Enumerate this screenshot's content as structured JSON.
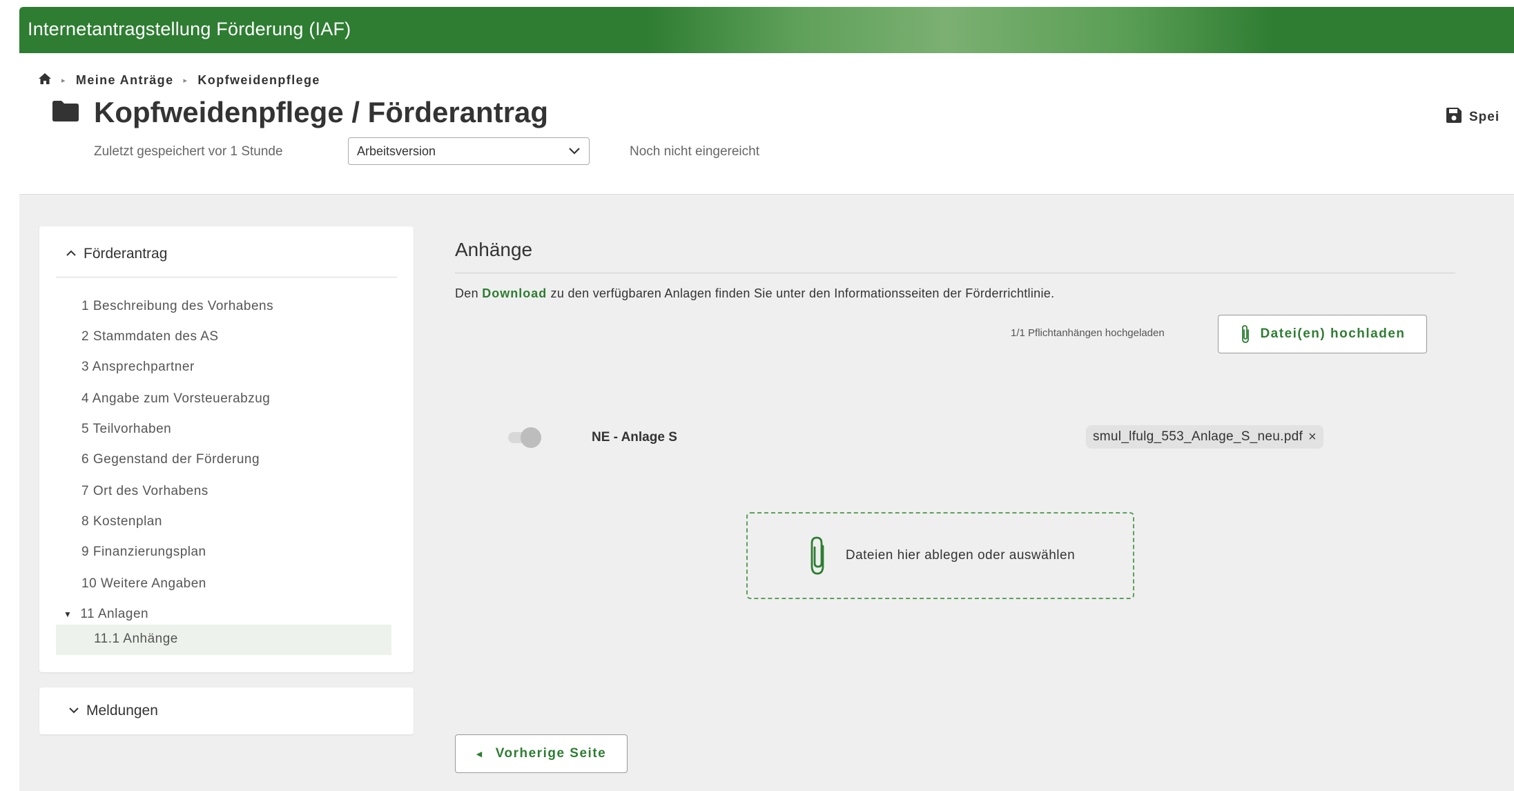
{
  "app": {
    "title": "Internetantragstellung Förderung (IAF)"
  },
  "breadcrumb": {
    "items": [
      "Meine Anträge",
      "Kopfweidenpflege"
    ]
  },
  "page": {
    "title": "Kopfweidenpflege / Förderantrag",
    "save_label": "Spei",
    "last_saved": "Zuletzt gespeichert vor 1 Stunde",
    "version_selected": "Arbeitsversion",
    "status": "Noch nicht eingereicht"
  },
  "sidebar": {
    "section_title": "Förderantrag",
    "items": [
      "1 Beschreibung des Vorhabens",
      "2 Stammdaten des AS",
      "3 Ansprechpartner",
      "4 Angabe zum Vorsteuerabzug",
      "5 Teilvorhaben",
      "6 Gegenstand der Förderung",
      "7 Ort des Vorhabens",
      "8 Kostenplan",
      "9 Finanzierungsplan",
      "10 Weitere Angaben"
    ],
    "group": "11 Anlagen",
    "active_item": "11.1 Anhänge",
    "second_section": "Meldungen"
  },
  "main": {
    "title": "Anhänge",
    "info_prefix": "Den",
    "info_link": "Download",
    "info_suffix": "zu den verfügbaren Anlagen finden Sie unter den Informationsseiten der Förderrichtlinie.",
    "upload_count": "1/1 Pflichtanhängen hochgeladen",
    "upload_button": "Datei(en) hochladen",
    "attachment_label": "NE - Anlage S",
    "file_name": "smul_lfulg_553_Anlage_S_neu.pdf",
    "dropzone_text": "Dateien hier ablegen oder auswählen",
    "prev_button": "Vorherige Seite"
  },
  "colors": {
    "brand": "#2e7d32",
    "background": "#efefef"
  }
}
